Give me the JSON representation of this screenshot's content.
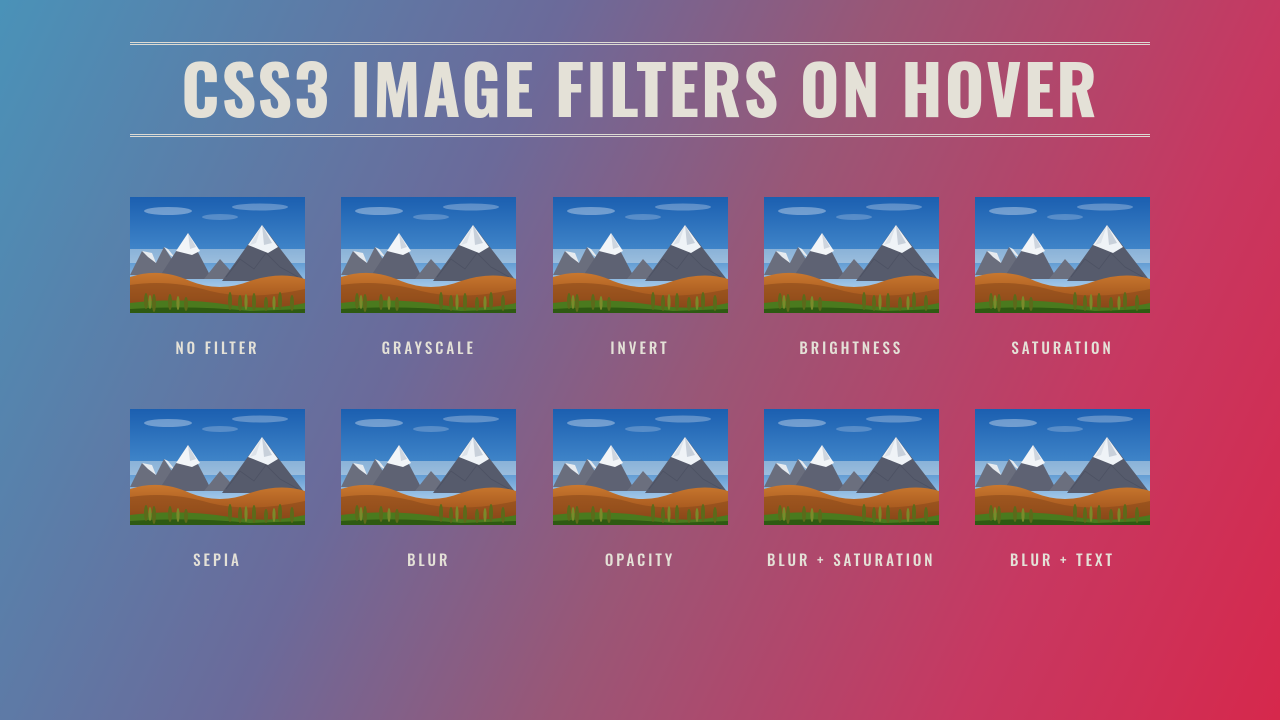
{
  "title": "CSS3 IMAGE FILTERS ON HOVER",
  "filters": [
    {
      "label": "NO FILTER"
    },
    {
      "label": "GRAYSCALE"
    },
    {
      "label": "INVERT"
    },
    {
      "label": "BRIGHTNESS"
    },
    {
      "label": "SATURATION"
    },
    {
      "label": "SEPIA"
    },
    {
      "label": "BLUR"
    },
    {
      "label": "OPACITY"
    },
    {
      "label": "BLUR + SATURATION"
    },
    {
      "label": "BLUR + TEXT"
    }
  ]
}
